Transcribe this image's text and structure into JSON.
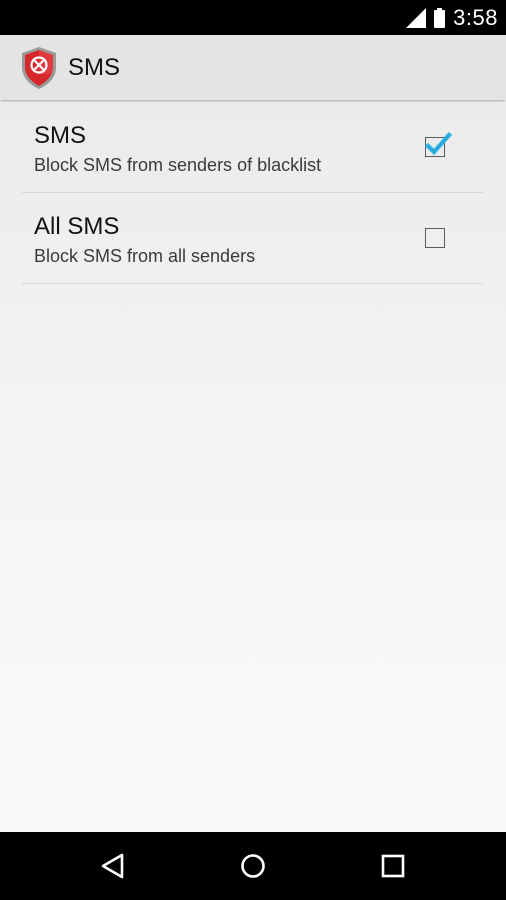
{
  "status_bar": {
    "time": "3:58",
    "icons": [
      "signal-icon",
      "battery-icon"
    ]
  },
  "action_bar": {
    "title": "SMS",
    "icon": "shield-block-icon",
    "colors": {
      "shield": "#d7262c",
      "shield_border": "#8a8a8a"
    }
  },
  "preferences": [
    {
      "title": "SMS",
      "summary": "Block SMS from senders of blacklist",
      "checked": true
    },
    {
      "title": "All SMS",
      "summary": "Block SMS from all senders",
      "checked": false
    }
  ],
  "nav_bar": {
    "buttons": [
      "back-icon",
      "home-icon",
      "recents-icon"
    ]
  },
  "colors": {
    "accent": "#33b5e5",
    "action_bar_bg": "#e4e4e4"
  }
}
